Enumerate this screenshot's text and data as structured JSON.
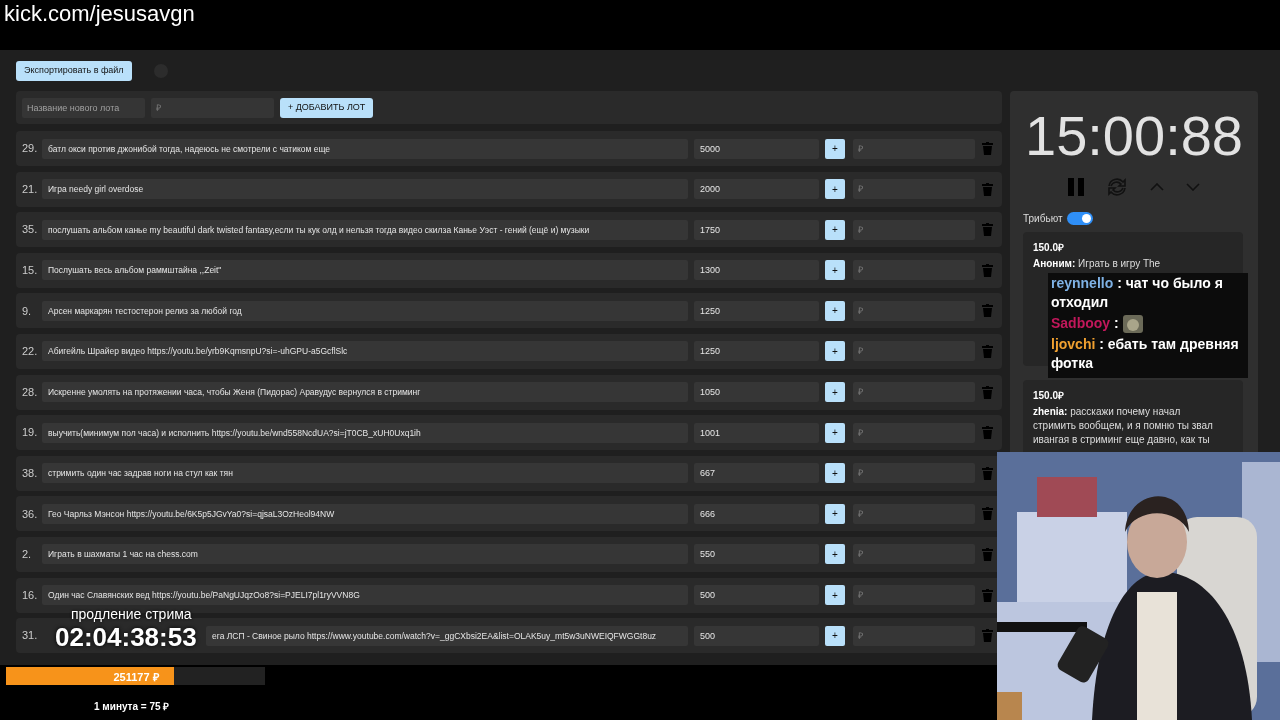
{
  "address_bar": {
    "url": "kick.com/jesusavgn"
  },
  "toolbar": {
    "export_button": "Экспортировать в файл"
  },
  "new_lot": {
    "name_placeholder": "Название нового лота",
    "price_placeholder": "₽",
    "add_button": "+ ДОБАВИТЬ ЛОТ"
  },
  "lots": [
    {
      "number": "29.",
      "name": "батл окси против джонибой тогда, надеюсь не смотрели с чатиком еще",
      "amount": "5000",
      "add_button": "+",
      "add_placeholder": "₽"
    },
    {
      "number": "21.",
      "name": "Игра needy girl overdose",
      "amount": "2000",
      "add_button": "+",
      "add_placeholder": "₽"
    },
    {
      "number": "35.",
      "name": "послушать альбом канье my beautiful dark twisted fantasy,если ты кук олд и нельзя тогда видео скилза Канье Уэст - гений (ещё и) музыки",
      "amount": "1750",
      "add_button": "+",
      "add_placeholder": "₽"
    },
    {
      "number": "15.",
      "name": "Послушать весь альбом раммштайна ,,Zeit\"",
      "amount": "1300",
      "add_button": "+",
      "add_placeholder": "₽"
    },
    {
      "number": "9.",
      "name": "Арсен маркарян тестостерон релиз за любой год",
      "amount": "1250",
      "add_button": "+",
      "add_placeholder": "₽"
    },
    {
      "number": "22.",
      "name": "Абигейль Шрайер видео https://youtu.be/yrb9KqmsnpU?si=-uhGPU-a5GcflSlc",
      "amount": "1250",
      "add_button": "+",
      "add_placeholder": "₽"
    },
    {
      "number": "28.",
      "name": "Искренне умолять на протяжении часа, чтобы Женя (Пидорас) Аравудус вернулся в стриминг",
      "amount": "1050",
      "add_button": "+",
      "add_placeholder": "₽"
    },
    {
      "number": "19.",
      "name": "выучить(минимум пол часа) и исполнить https://youtu.be/wnd558NcdUA?si=jT0CB_xUH0Uxq1ih",
      "amount": "1001",
      "add_button": "+",
      "add_placeholder": "₽"
    },
    {
      "number": "38.",
      "name": "стримить один час задрав ноги на стул как тян",
      "amount": "667",
      "add_button": "+",
      "add_placeholder": "₽"
    },
    {
      "number": "36.",
      "name": "Гео Чарльз Мэнсон https://youtu.be/6K5p5JGvYa0?si=qjsaL3OzHeol94NW",
      "amount": "666",
      "add_button": "+",
      "add_placeholder": "₽"
    },
    {
      "number": "2.",
      "name": "Играть в шахматы 1 час на chess.com",
      "amount": "550",
      "add_button": "+",
      "add_placeholder": "₽"
    },
    {
      "number": "16.",
      "name": "Один час Славянских вед https://youtu.be/PaNgUJqzOo8?si=PJELI7pl1ryVVN8G",
      "amount": "500",
      "add_button": "+",
      "add_placeholder": "₽"
    },
    {
      "number": "31.",
      "name": "ега ЛСП - Свиное рыло https://www.youtube.com/watch?v=_ggCXbsi2EA&list=OLAK5uy_mt5w3uNWEIQFWGGt8uz",
      "amount": "500",
      "add_button": "+",
      "add_placeholder": "₽",
      "partly_hidden": true
    }
  ],
  "timer": {
    "time": "15:00:88"
  },
  "tribute": {
    "label": "Трибьют",
    "on": true
  },
  "donations": [
    {
      "amount": "150.0₽",
      "author": "Аноним:",
      "message": "Играть в игру The"
    },
    {
      "amount": "150.0₽",
      "author": "zhenia:",
      "message": "расскажи почему начал стримить вообщем, и я помню ты звал ивангая в стриминг еще давно, как ты"
    }
  ],
  "chat_overlay": {
    "messages": [
      {
        "user": "reynnello",
        "color": "#7fb2e5",
        "kind": "text",
        "text": ": чат чо было я отходил"
      },
      {
        "user": "Sadbooy",
        "color": "#c2185b",
        "kind": "emote",
        "text": ":"
      },
      {
        "user": "ljovchi",
        "color": "#f0a030",
        "kind": "text",
        "text": ": ебать там древняя фотка"
      }
    ]
  },
  "stream_overlay": {
    "label": "продление стрима",
    "countdown": "02:04:38:53"
  },
  "goal": {
    "amount": "251177 ₽",
    "level": 0.65,
    "rate": "1 минута = 75 ₽"
  }
}
